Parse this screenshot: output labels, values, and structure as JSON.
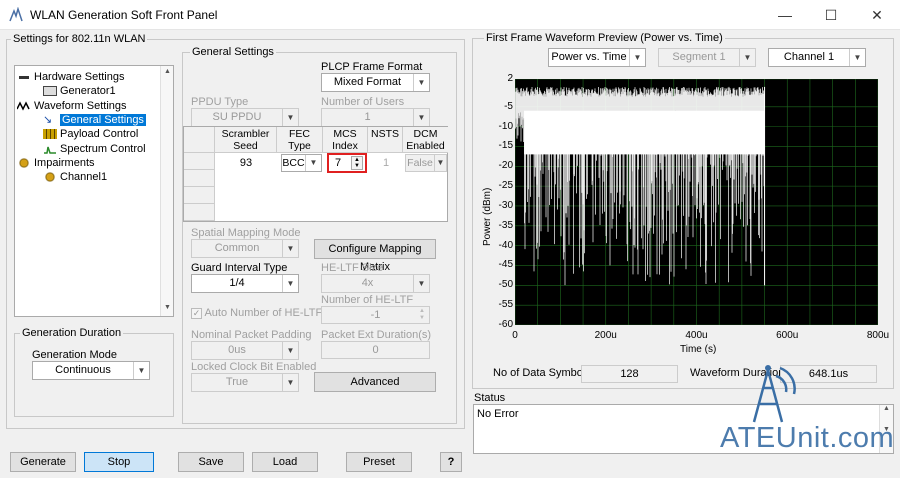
{
  "window": {
    "title": "WLAN Generation Soft Front Panel",
    "min": "—",
    "max": "☐",
    "close": "✕"
  },
  "settings_group": {
    "label": "Settings for 802.11n WLAN"
  },
  "tree": [
    {
      "label": "Hardware Settings"
    },
    {
      "label": "Generator1"
    },
    {
      "label": "Waveform Settings"
    },
    {
      "label": "General Settings"
    },
    {
      "label": "Payload Control"
    },
    {
      "label": "Spectrum Control"
    },
    {
      "label": "Impairments"
    },
    {
      "label": "Channel1"
    }
  ],
  "duration": {
    "group_label": "Generation Duration",
    "mode_label": "Generation Mode",
    "mode_value": "Continuous"
  },
  "general": {
    "group_label": "General Settings",
    "plcp_label": "PLCP Frame Format",
    "plcp_value": "Mixed Format",
    "ppdu_label": "PPDU Type",
    "ppdu_value": "SU PPDU",
    "users_label": "Number of Users",
    "users_value": "1",
    "table": {
      "headers": [
        "Scrambler Seed",
        "FEC Type",
        "MCS Index",
        "NSTS",
        "DCM Enabled"
      ],
      "row": {
        "seed": "93",
        "fec": "BCC",
        "mcs": "7",
        "nsts": "1",
        "dcm": "False"
      }
    },
    "spatial_label": "Spatial Mapping Mode",
    "spatial_value": "Common",
    "mapping_button": "Configure Mapping Matrix",
    "guard_label": "Guard Interval Type",
    "guard_value": "1/4",
    "heltf_label": "HE-LTF Size",
    "heltf_value": "4x",
    "auto_heltf_label": "Auto Number of HE-LTF",
    "num_heltf_label": "Number of HE-LTF",
    "num_heltf_value": "-1",
    "padding_label": "Nominal Packet Padding",
    "padding_value": "0us",
    "ext_label": "Packet Ext Duration(s)",
    "ext_value": "0",
    "locked_label": "Locked Clock Bit Enabled",
    "locked_value": "True",
    "advanced_button": "Advanced"
  },
  "preview": {
    "group_label": "First Frame Waveform Preview (Power vs. Time)",
    "view_value": "Power vs. Time",
    "segment_value": "Segment 1",
    "channel_value": "Channel 1",
    "ylabel": "Power (dBm)",
    "xlabel": "Time (s)",
    "data_symbols_label": "No of Data Symbols",
    "data_symbols_value": "128",
    "duration_label": "Waveform Duration",
    "duration_value": "648.1us"
  },
  "chart_data": {
    "type": "line",
    "xlabel": "Time (s)",
    "ylabel": "Power (dBm)",
    "xlim": [
      0,
      0.0008
    ],
    "ylim": [
      -60,
      2
    ],
    "x_ticks": [
      "0",
      "200u",
      "400u",
      "600u",
      "800u"
    ],
    "y_ticks": [
      "2",
      "-5",
      "-10",
      "-15",
      "-20",
      "-25",
      "-30",
      "-35",
      "-40",
      "-45",
      "-50",
      "-55",
      "-60"
    ],
    "grid": true,
    "series": [
      {
        "color": "#ffffff",
        "signal_end_x": 0.00055,
        "peak_y": 0,
        "mean_y": -3,
        "floor_y": -50
      }
    ]
  },
  "status": {
    "label": "Status",
    "text": "No Error"
  },
  "watermark": "ATEUnit.com",
  "buttons": {
    "generate": "Generate",
    "stop": "Stop",
    "save": "Save",
    "load": "Load",
    "preset": "Preset",
    "help": "?"
  }
}
